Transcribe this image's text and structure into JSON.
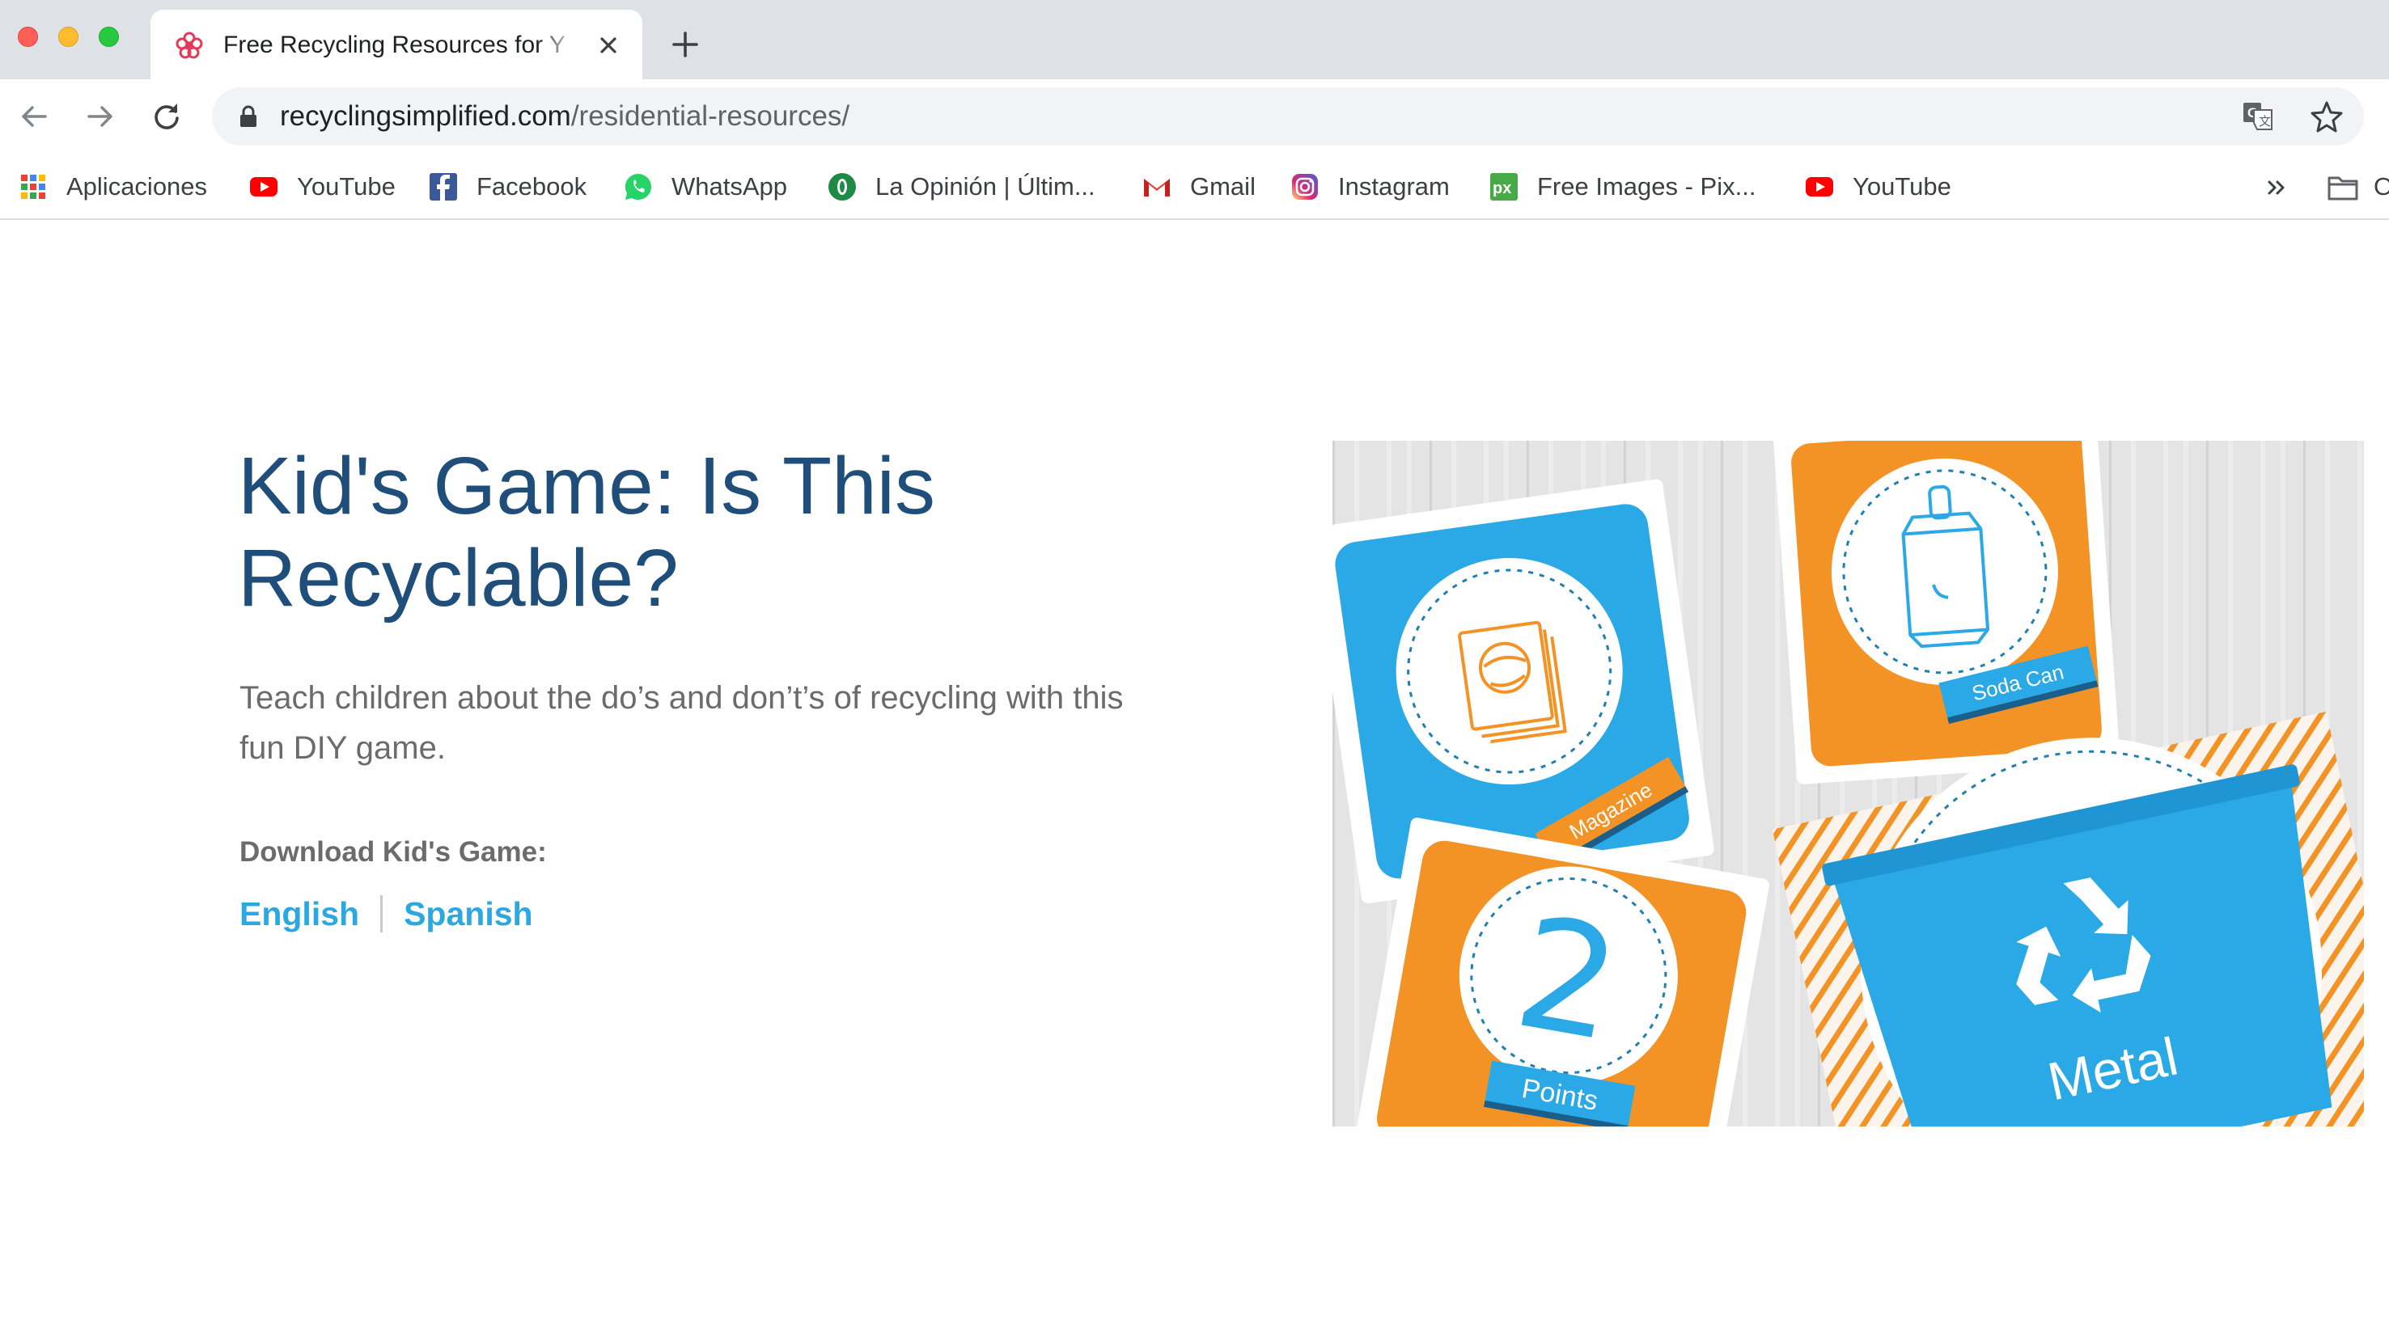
{
  "browser": {
    "tab": {
      "title": "Free Recycling Resources for Y",
      "favicon": "flower-favicon-icon"
    },
    "address_bar": {
      "domain": "recyclingsimplified.com",
      "path": "/residential-resources/"
    },
    "bookmarks": [
      {
        "label": "Aplicaciones",
        "icon": "apps-grid-icon"
      },
      {
        "label": "YouTube",
        "icon": "youtube-icon"
      },
      {
        "label": "Facebook",
        "icon": "facebook-icon"
      },
      {
        "label": "WhatsApp",
        "icon": "whatsapp-icon"
      },
      {
        "label": "La Opinión | Últim...",
        "icon": "la-opinion-icon"
      },
      {
        "label": "Gmail",
        "icon": "gmail-icon"
      },
      {
        "label": "Instagram",
        "icon": "instagram-icon"
      },
      {
        "label": "Free Images - Pix...",
        "icon": "pixabay-icon"
      },
      {
        "label": "YouTube",
        "icon": "youtube-icon"
      }
    ],
    "bookmarks_overflow_label": "O"
  },
  "page": {
    "heading": "Kid's Game: Is This Recyclable?",
    "description": "Teach children about the do’s and don’t’s of recycling with this fun DIY game.",
    "download_label": "Download Kid's Game:",
    "links": {
      "english": "English",
      "spanish": "Spanish"
    }
  },
  "illustration": {
    "cards": {
      "magazine": "Magazine",
      "soda_can": "Soda Can",
      "points_number": "2",
      "points": "Points",
      "bin": "Metal"
    }
  },
  "colors": {
    "heading": "#1f4e7a",
    "link": "#2ba8e0",
    "card_blue": "#2aa9e6",
    "card_orange": "#f39325"
  }
}
